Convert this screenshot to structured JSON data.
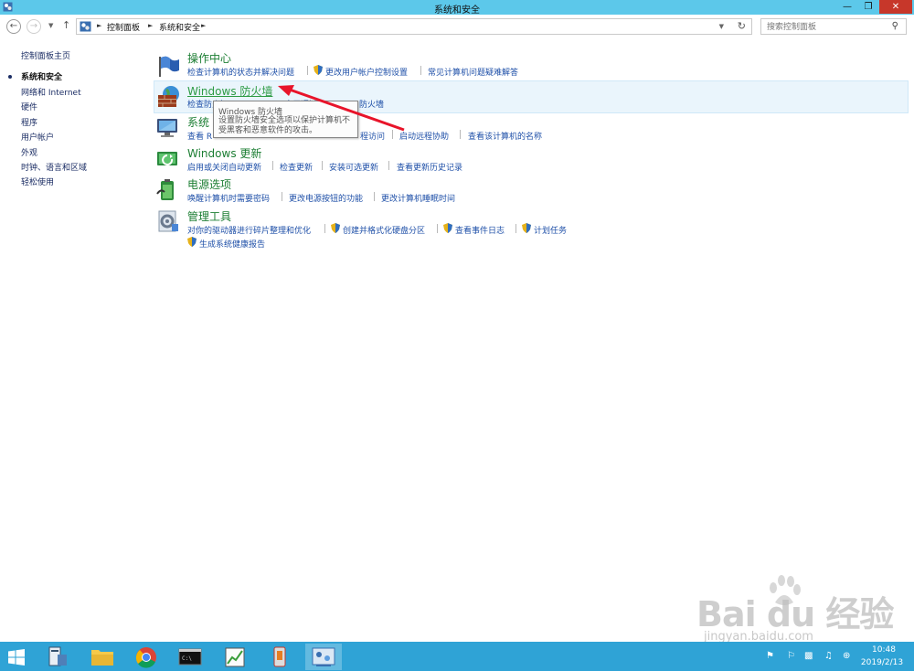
{
  "window": {
    "title": "系统和安全"
  },
  "window_controls": {
    "minimize": "—",
    "maximize": "❐",
    "close": "✕"
  },
  "address": {
    "breadcrumbs": [
      "控制面板",
      "系统和安全"
    ],
    "search_placeholder": "搜索控制面板"
  },
  "left_nav": {
    "home": "控制面板主页",
    "items": [
      "系统和安全",
      "网络和 Internet",
      "硬件",
      "程序",
      "用户帐户",
      "外观",
      "时钟、语言和区域",
      "轻松使用"
    ]
  },
  "categories": [
    {
      "title": "操作中心",
      "links": [
        "检查计算机的状态并解决问题",
        "更改用户帐户控制设置",
        "常见计算机问题疑难解答"
      ]
    },
    {
      "title": "Windows 防火墙",
      "links": [
        "检查防火墙状态",
        "允许应用通过 Windows 防火墙"
      ]
    },
    {
      "title": "系统",
      "links": [
        "查看 R",
        "程访问",
        "启动远程协助",
        "查看该计算机的名称"
      ]
    },
    {
      "title": "Windows 更新",
      "links": [
        "启用或关闭自动更新",
        "检查更新",
        "安装可选更新",
        "查看更新历史记录"
      ]
    },
    {
      "title": "电源选项",
      "links": [
        "唤醒计算机时需要密码",
        "更改电源按钮的功能",
        "更改计算机睡眠时间"
      ]
    },
    {
      "title": "管理工具",
      "links": [
        "对你的驱动器进行碎片整理和优化",
        "创建并格式化硬盘分区",
        "查看事件日志",
        "计划任务",
        "生成系统健康报告"
      ]
    }
  ],
  "tooltip": {
    "title": "Windows 防火墙",
    "body": "设置防火墙安全选项以保护计算机不受黑客和恶意软件的攻击。"
  },
  "watermark": {
    "brand": "Bai du 经验",
    "url": "jingyan.baidu.com"
  },
  "taskbar": {
    "time": "10:48",
    "date": "2019/2/13"
  },
  "colors": {
    "titlebar": "#5cc8ea",
    "taskbar": "#2fa3d6",
    "category_title": "#1c7e33",
    "link": "#1f50a8",
    "arrow": "#e8142a"
  }
}
